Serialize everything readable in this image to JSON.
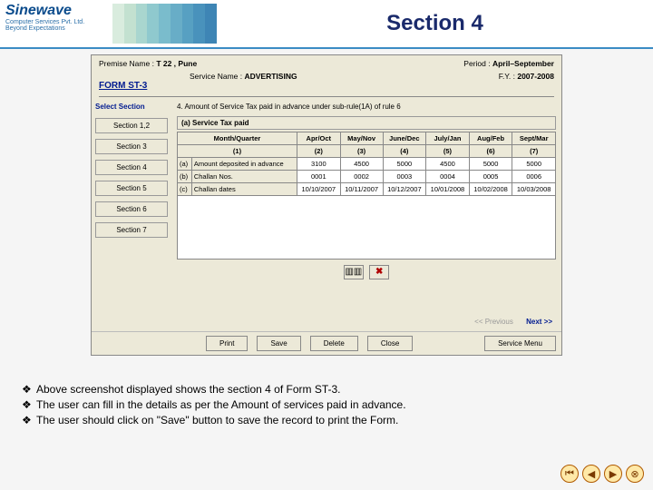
{
  "header": {
    "logo_title": "Sinewave",
    "logo_sub1": "Computer Services Pvt. Ltd.",
    "logo_sub2": "Beyond Expectations",
    "slide_title": "Section 4"
  },
  "app": {
    "premise_label": "Premise Name :",
    "premise_value": "T 22    , Pune",
    "period_label": "Period :",
    "period_value": "April–September",
    "service_label": "Service Name :",
    "service_value": "ADVERTISING",
    "fy_label": "F.Y. :",
    "fy_value": "2007-2008",
    "form_title": "FORM ST-3",
    "select_section": "Select Section",
    "sections": [
      "Section 1,2",
      "Section 3",
      "Section 4",
      "Section 5",
      "Section 6",
      "Section 7"
    ],
    "line4": "4.    Amount of Service Tax paid in advance under sub-rule(1A) of rule 6",
    "subhead": "(a)    Service Tax paid",
    "columns_top": [
      "Month/Quarter",
      "Apr/Oct",
      "May/Nov",
      "June/Dec",
      "July/Jan",
      "Aug/Feb",
      "Sept/Mar"
    ],
    "columns_num": [
      "(1)",
      "(2)",
      "(3)",
      "(4)",
      "(5)",
      "(6)",
      "(7)"
    ],
    "rows": [
      {
        "idx": "(a)",
        "label": "Amount deposited in advance",
        "v": [
          "3100",
          "4500",
          "5000",
          "4500",
          "5000",
          "5000"
        ]
      },
      {
        "idx": "(b)",
        "label": "Challan Nos.",
        "v": [
          "0001",
          "0002",
          "0003",
          "0004",
          "0005",
          "0006"
        ]
      },
      {
        "idx": "(c)",
        "label": "Challan dates",
        "v": [
          "10/10/2007",
          "10/11/2007",
          "10/12/2007",
          "10/01/2008",
          "10/02/2008",
          "10/03/2008"
        ]
      }
    ],
    "nav_prev": "<< Previous",
    "nav_next": "Next >>",
    "buttons": {
      "print": "Print",
      "save": "Save",
      "delete": "Delete",
      "close": "Close",
      "service": "Service Menu"
    }
  },
  "notes": [
    "Above screenshot displayed shows the section 4 of Form ST-3.",
    "The user can fill in the details as per the Amount of services paid in advance.",
    "The user should click on \"Save\" button to save the record  to print the Form."
  ],
  "nav_icons": [
    "⏮",
    "◀",
    "▶",
    "⊗"
  ]
}
